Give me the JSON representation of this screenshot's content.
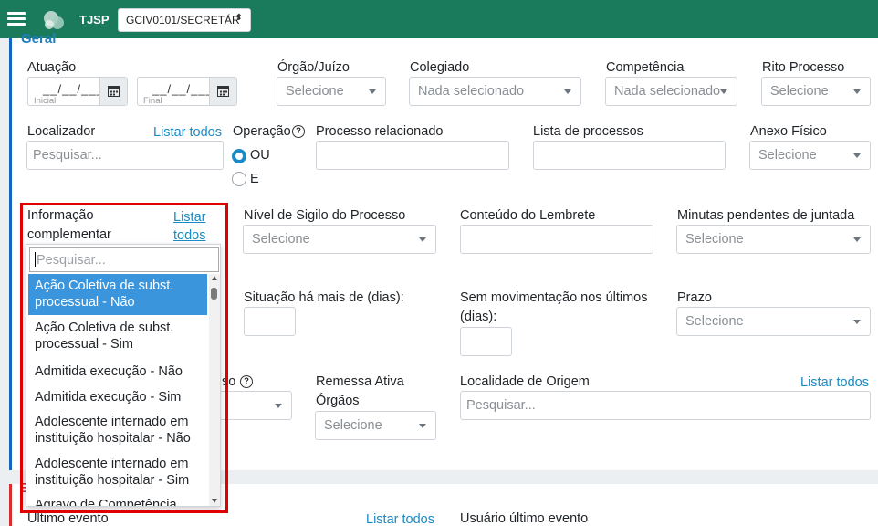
{
  "topbar": {
    "brand": "TJSP",
    "unit_value": "GCIV0101/SECRETÁR",
    "caret": "⬍"
  },
  "card": {
    "title": "Geral"
  },
  "row1": {
    "atuacao_label": "Atuação",
    "date_mask": "__/__/____",
    "inicial": "Inicial",
    "final": "Final",
    "orgao_label": "Órgão/Juízo",
    "orgao_value": "Selecione",
    "colegiado_label": "Colegiado",
    "colegiado_value": "Nada selecionado",
    "competencia_label": "Competência",
    "competencia_value": "Nada selecionado",
    "rito_label": "Rito Processo",
    "rito_value": "Selecione"
  },
  "row2": {
    "localizador_label": "Localizador",
    "listar_todos": "Listar todos",
    "localizador_placeholder": "Pesquisar...",
    "operacao_label": "Operação",
    "help": "?",
    "ou": "OU",
    "e": "E",
    "processo_relacionado_label": "Processo relacionado",
    "lista_processos_label": "Lista de processos",
    "anexo_label": "Anexo Físico",
    "anexo_value": "Selecione"
  },
  "row3": {
    "info_label_1": "Informação",
    "info_label_2": "complementar",
    "listar_1": "Listar",
    "listar_2": "todos",
    "sigilo_label": "Nível de Sigilo do Processo",
    "sigilo_value": "Selecione",
    "lembrete_label": "Conteúdo do Lembrete",
    "minutas_label": "Minutas pendentes de juntada",
    "minutas_value": "Selecione"
  },
  "row4": {
    "situacao_label": "Situação há mais de (dias):",
    "sem_mov_label_1": "Sem movimentação nos últimos",
    "sem_mov_label_2": "(dias):",
    "prazo_label": "Prazo",
    "prazo_value": "Selecione"
  },
  "row5": {
    "partial_label": "so",
    "remessa_label_1": "Remessa Ativa",
    "remessa_label_2": "Órgãos",
    "remessa_value": "Selecione",
    "localidade_label": "Localidade de Origem",
    "listar_todos": "Listar todos",
    "localidade_placeholder": "Pesquisar..."
  },
  "bottom": {
    "ultimo_evento_label": "Último evento",
    "listar_todos": "Listar todos",
    "usuario_label": "Usuário último evento",
    "partial_e": "E"
  },
  "dropdown": {
    "search_placeholder": "Pesquisar...",
    "options": [
      {
        "line1": "Ação Coletiva de subst.",
        "line2": "processual - Não"
      },
      {
        "line1": "Ação Coletiva de subst.",
        "line2": "processual - Sim"
      },
      {
        "line1": "Admitida execução - Não",
        "line2": ""
      },
      {
        "line1": "Admitida execução - Sim",
        "line2": ""
      },
      {
        "line1": "Adolescente internado em",
        "line2": "instituição hospitalar - Não"
      },
      {
        "line1": "Adolescente internado em",
        "line2": "instituição hospitalar - Sim"
      },
      {
        "line1": "Agravo de Competência",
        "line2": ""
      }
    ]
  },
  "colors": {
    "topbar": "#1a7a5c",
    "link": "#1a8bc5",
    "highlight_option": "#3a95dd",
    "annotation_box": "#e00000"
  }
}
